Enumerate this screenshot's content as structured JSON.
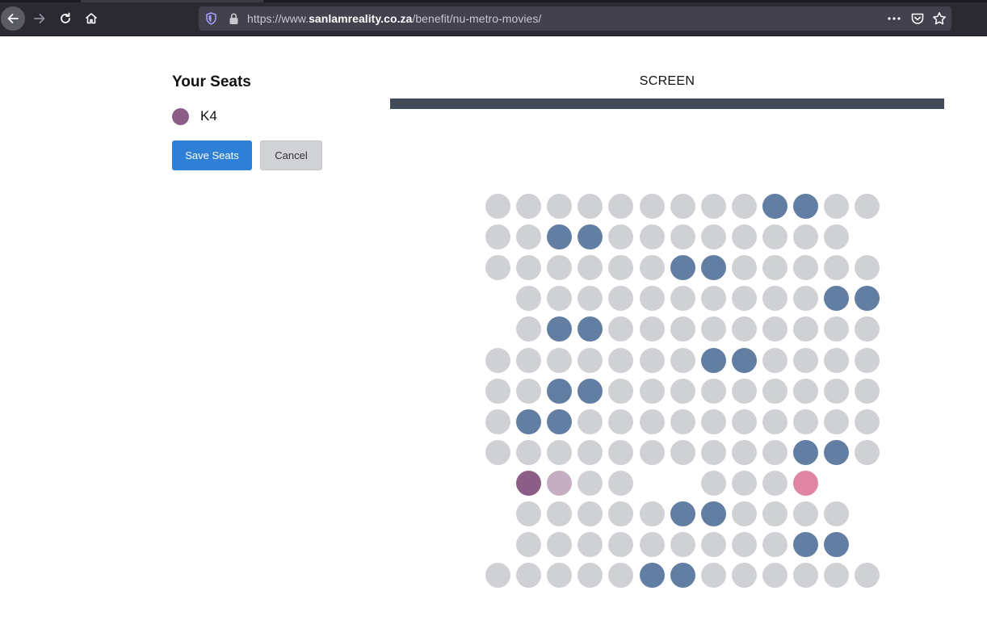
{
  "browser": {
    "url_prefix": "https://www.",
    "url_host": "sanlamreality.co.za",
    "url_path": "/benefit/nu-metro-movies/"
  },
  "seat_panel": {
    "title": "Your Seats",
    "selected_seats": [
      "K4"
    ],
    "save_label": "Save Seats",
    "cancel_label": "Cancel"
  },
  "screen": {
    "label": "SCREEN"
  },
  "seat_map": {
    "columns": 13,
    "legend_colors": {
      "available": "#cfd1d4",
      "taken": "#627ea2",
      "selected": "#8c5d86",
      "selected_alt": "#c6aec2",
      "special": "#e085a4"
    },
    "rows": [
      [
        "a",
        "a",
        "a",
        "a",
        "a",
        "a",
        "a",
        "a",
        "a",
        "t",
        "t",
        "a",
        "a"
      ],
      [
        "a",
        "a",
        "t",
        "t",
        "a",
        "a",
        "a",
        "a",
        "a",
        "a",
        "a",
        "a",
        "-"
      ],
      [
        "a",
        "a",
        "a",
        "a",
        "a",
        "a",
        "t",
        "t",
        "a",
        "a",
        "a",
        "a",
        "a"
      ],
      [
        "-",
        "a",
        "a",
        "a",
        "a",
        "a",
        "a",
        "a",
        "a",
        "a",
        "a",
        "t",
        "t"
      ],
      [
        "-",
        "a",
        "t",
        "t",
        "a",
        "a",
        "a",
        "a",
        "a",
        "a",
        "a",
        "a",
        "a"
      ],
      [
        "a",
        "a",
        "a",
        "a",
        "a",
        "a",
        "a",
        "t",
        "t",
        "a",
        "a",
        "a",
        "a"
      ],
      [
        "a",
        "a",
        "t",
        "t",
        "a",
        "a",
        "a",
        "a",
        "a",
        "a",
        "a",
        "a",
        "a"
      ],
      [
        "a",
        "t",
        "t",
        "a",
        "a",
        "a",
        "a",
        "a",
        "a",
        "a",
        "a",
        "a",
        "a"
      ],
      [
        "a",
        "a",
        "a",
        "a",
        "a",
        "a",
        "a",
        "a",
        "a",
        "a",
        "t",
        "t",
        "a"
      ],
      [
        "-",
        "s",
        "x",
        "a",
        "a",
        "-",
        "-",
        "a",
        "a",
        "a",
        "p",
        "-",
        "-"
      ],
      [
        "-",
        "a",
        "a",
        "a",
        "a",
        "a",
        "t",
        "t",
        "a",
        "a",
        "a",
        "a",
        "-"
      ],
      [
        "-",
        "a",
        "a",
        "a",
        "a",
        "a",
        "a",
        "a",
        "a",
        "a",
        "t",
        "t",
        "-"
      ],
      [
        "a",
        "a",
        "a",
        "a",
        "a",
        "t",
        "t",
        "a",
        "a",
        "a",
        "a",
        "a",
        "a"
      ]
    ]
  }
}
